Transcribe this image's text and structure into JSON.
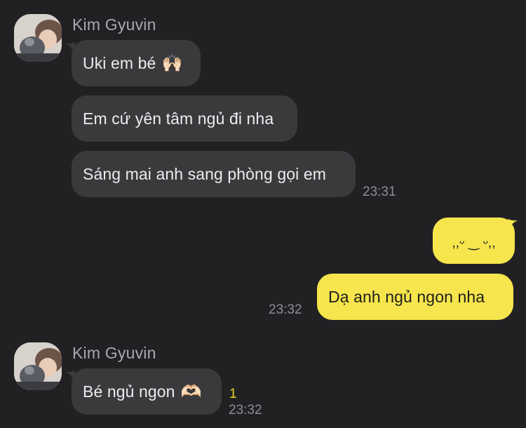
{
  "group1": {
    "sender": "Kim Gyuvin",
    "messages": [
      {
        "text": "Uki em bé",
        "emoji": "🙌🏻"
      },
      {
        "text": "Em cứ yên tâm ngủ đi nha"
      },
      {
        "text": "Sáng mai anh sang phòng gọi em"
      }
    ],
    "time": "23:31"
  },
  "outgoing": {
    "messages": [
      {
        "text": ",,ᵕ ‿ ᵕ,,"
      },
      {
        "text": "Dạ anh ngủ ngon nha"
      }
    ],
    "time": "23:32"
  },
  "group2": {
    "sender": "Kim Gyuvin",
    "messages": [
      {
        "text": "Bé ngủ ngon",
        "emoji": "🫶🏻"
      }
    ],
    "unread": "1",
    "time": "23:32"
  },
  "colors": {
    "background": "#212124",
    "incoming_bubble": "#3a3a3d",
    "outgoing_bubble": "#f6e54c",
    "unread": "#f5d020"
  }
}
